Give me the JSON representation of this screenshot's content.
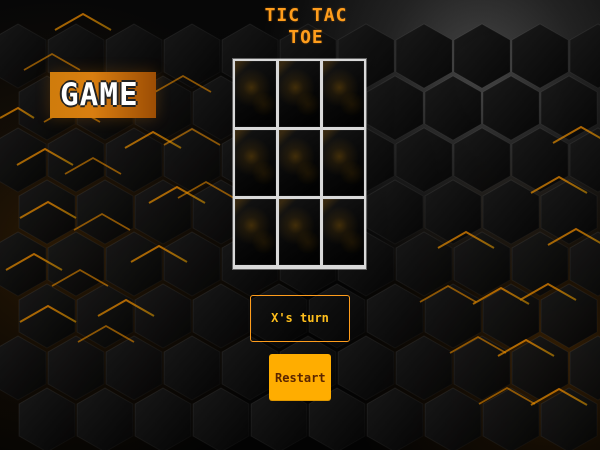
{
  "game": {
    "title": "TIC TAC TOE",
    "logo_text": "GAME",
    "status_text": "X's turn",
    "restart_label": "Restart",
    "board": {
      "rows": 3,
      "cols": 3,
      "cells": [
        "",
        "",
        "",
        "",
        "",
        "",
        "",
        "",
        ""
      ]
    }
  },
  "colors": {
    "accent": "#ffad00",
    "title": "#ff9d1c",
    "status": "#ffbf1c",
    "board_border": "#d9d9d9",
    "background": "#050505"
  }
}
